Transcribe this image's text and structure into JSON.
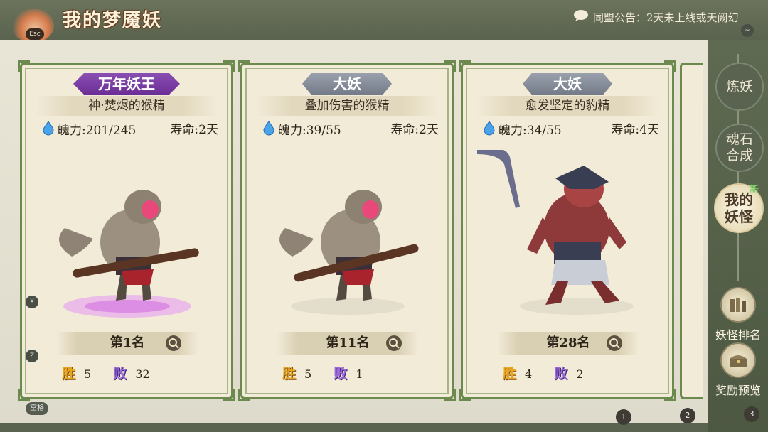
{
  "header": {
    "title": "我的梦魇妖",
    "esc_label": "Esc",
    "announcement": "同盟公告：2天未上线或天阙幻"
  },
  "hotkeys": {
    "x": "X",
    "z": "Z",
    "space": "空格",
    "tilde": "~"
  },
  "cards": [
    {
      "tier": "万年妖王",
      "tier_color": "#7a3fa6",
      "name": "神·焚烬的猴精",
      "power_label": "魄力:",
      "power_value": "201/245",
      "life_label": "寿命:",
      "life_value": "2天",
      "rank": "第1名",
      "win_label": "胜",
      "wins": "5",
      "lose_label": "败",
      "losses": "32",
      "creature": "monkey-with-club",
      "aura_color": "#d78ee8"
    },
    {
      "tier": "大妖",
      "tier_color": "#868d99",
      "name": "叠加伤害的猴精",
      "power_label": "魄力:",
      "power_value": "39/55",
      "life_label": "寿命:",
      "life_value": "2天",
      "rank": "第11名",
      "win_label": "胜",
      "wins": "5",
      "lose_label": "败",
      "losses": "1",
      "creature": "monkey-with-club",
      "aura_color": "#e5e0d0"
    },
    {
      "tier": "大妖",
      "tier_color": "#868d99",
      "name": "愈发坚定的豹精",
      "power_label": "魄力:",
      "power_value": "34/55",
      "life_label": "寿命:",
      "life_value": "4天",
      "rank": "第28名",
      "win_label": "胜",
      "wins": "4",
      "lose_label": "败",
      "losses": "2",
      "creature": "armored-leopard-demon",
      "aura_color": "#e5e0d0"
    }
  ],
  "sidebar": {
    "refine": "炼妖",
    "soulstone_line1": "魂石",
    "soulstone_line2": "合成",
    "mine_line1": "我的",
    "mine_line2": "妖怪",
    "new_tag": "新",
    "ranking": "妖怪排名",
    "rewards": "奖励预览"
  },
  "pagination": [
    "1",
    "2",
    "3"
  ]
}
